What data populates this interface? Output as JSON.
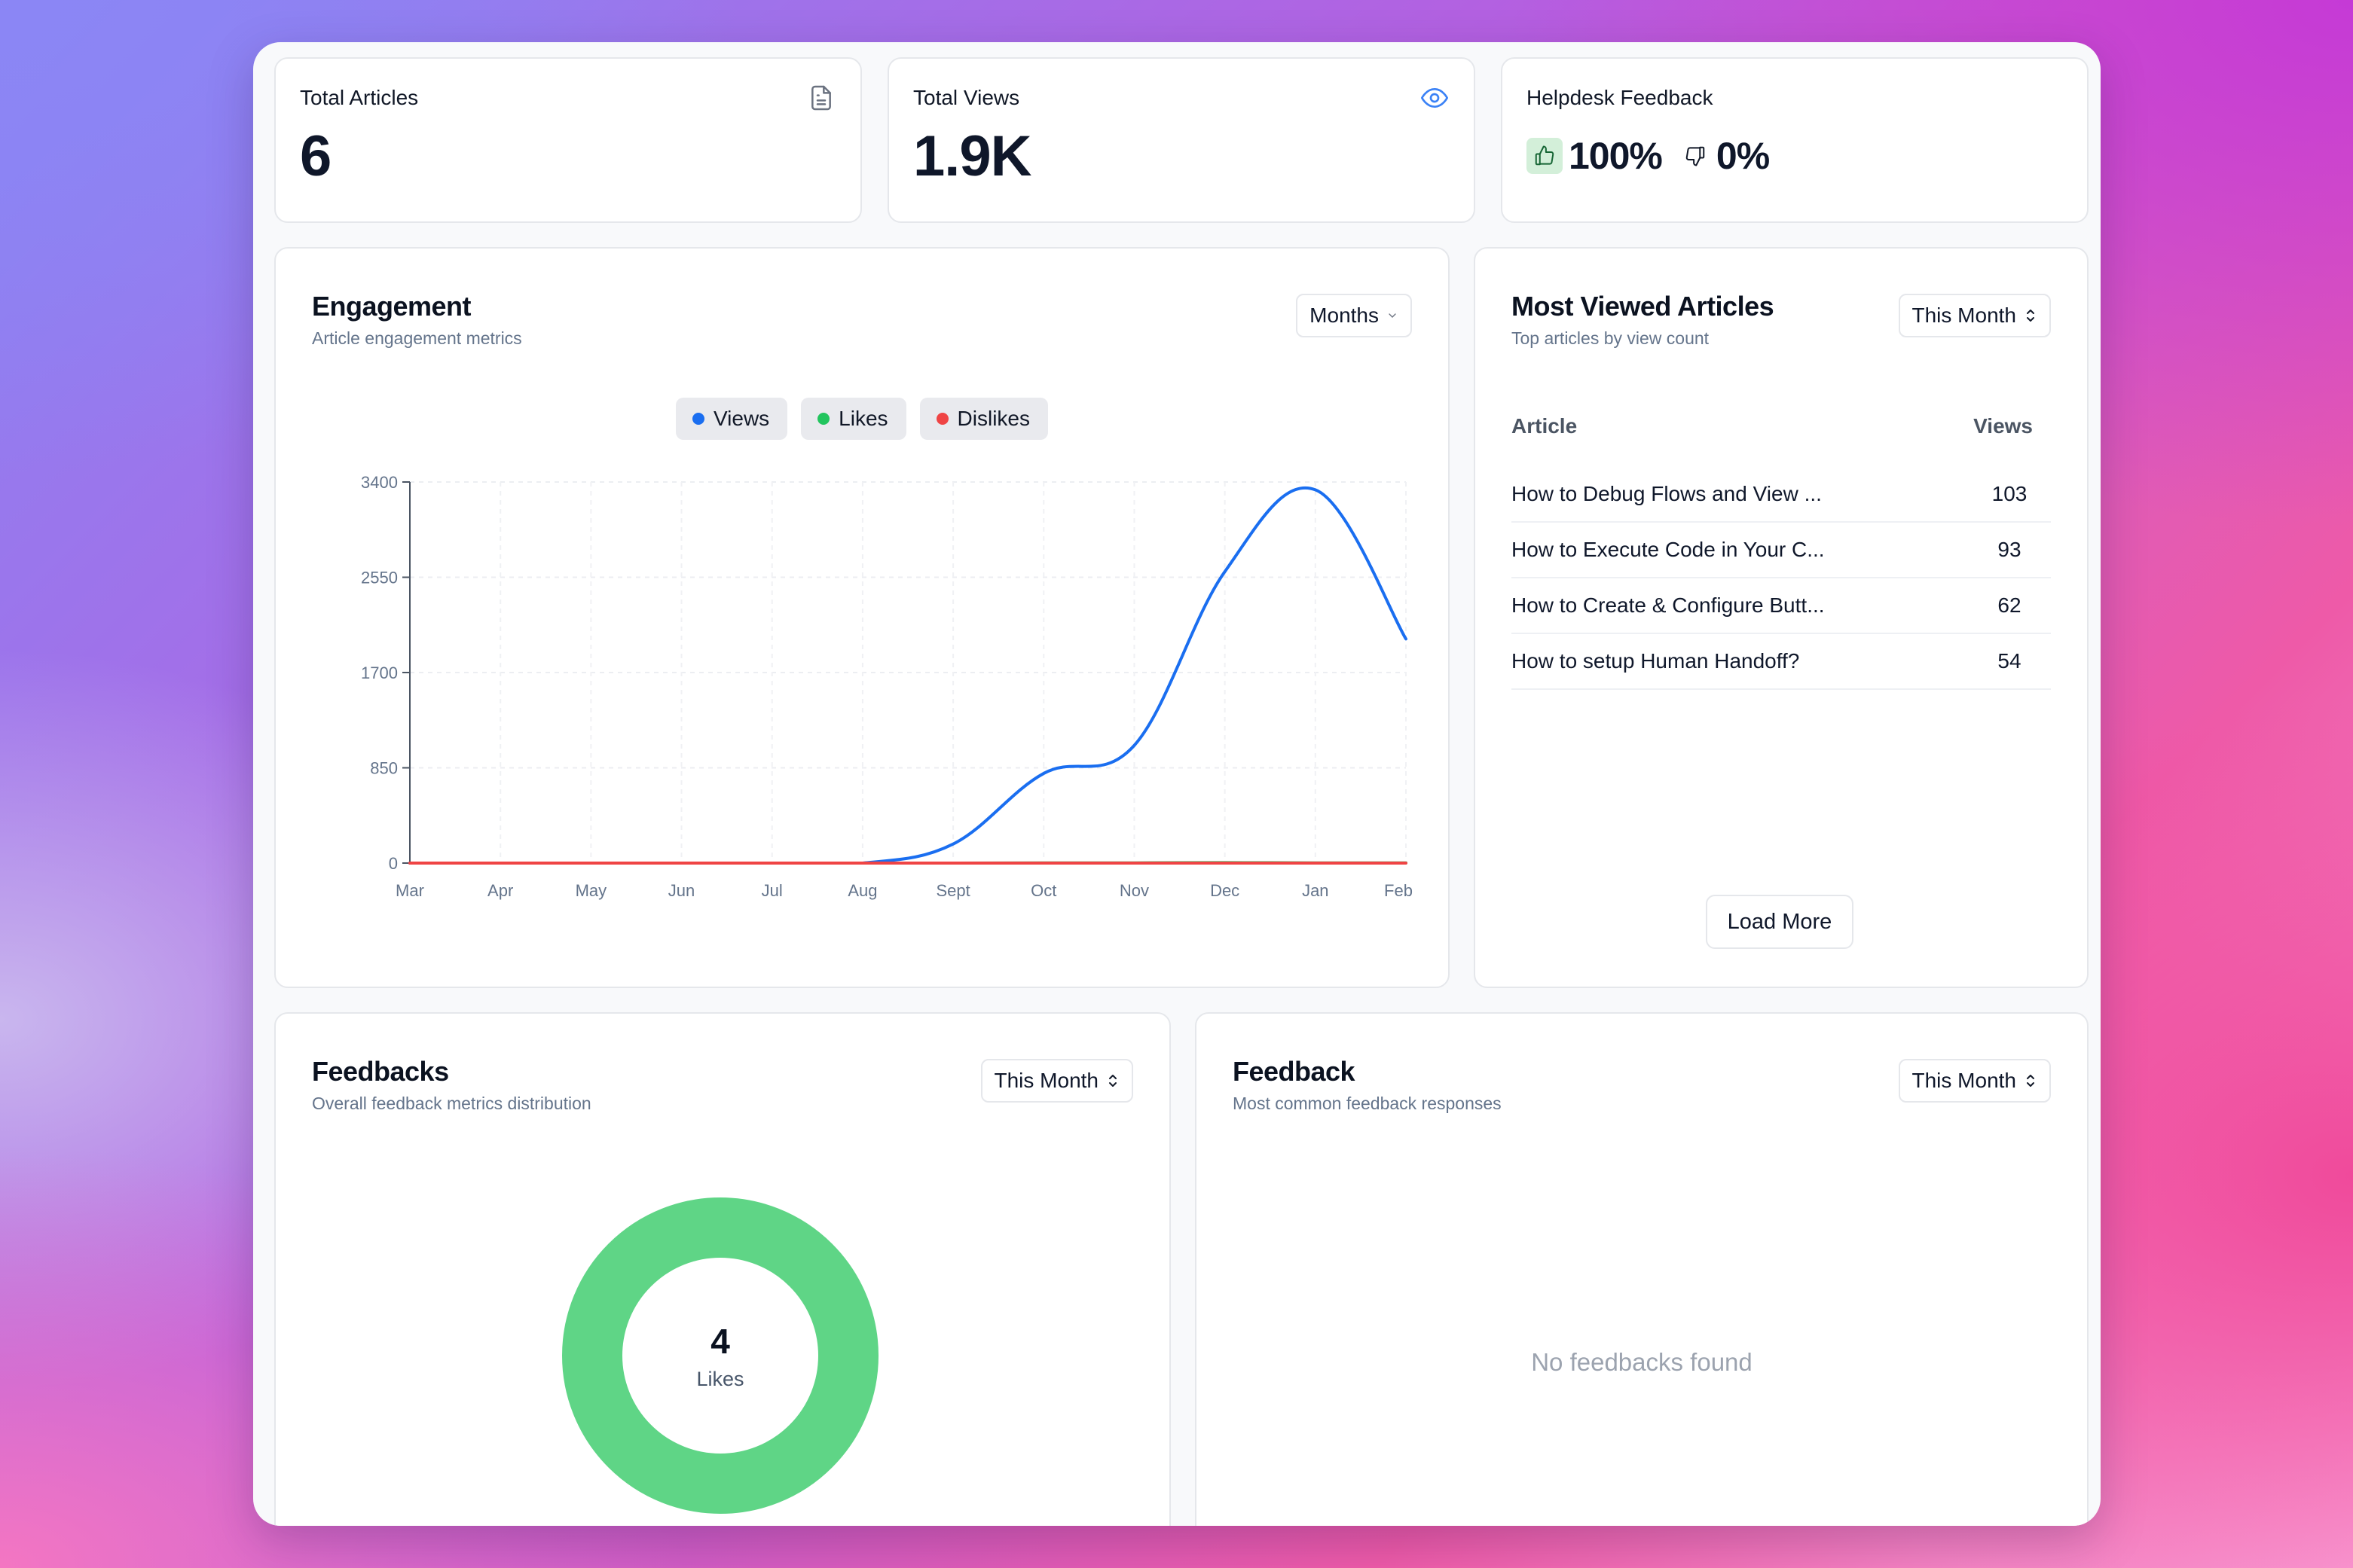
{
  "stats": {
    "total_articles": {
      "label": "Total Articles",
      "value": "6",
      "icon": "document-icon"
    },
    "total_views": {
      "label": "Total Views",
      "value": "1.9K",
      "icon": "eye-icon",
      "icon_color": "#3b82f6"
    },
    "helpdesk_feedback": {
      "label": "Helpdesk Feedback",
      "positive": "100%",
      "negative": "0%",
      "positive_icon": "thumbs-up-icon",
      "negative_icon": "thumbs-down-icon",
      "positive_bg": "#d3efd9"
    }
  },
  "engagement": {
    "title": "Engagement",
    "subtitle": "Article engagement metrics",
    "period_select": "Months",
    "legend": [
      {
        "name": "Views",
        "color": "#1a6ef0"
      },
      {
        "name": "Likes",
        "color": "#22c55e"
      },
      {
        "name": "Dislikes",
        "color": "#ef4444"
      }
    ]
  },
  "chart_data": {
    "type": "line",
    "title": "Engagement",
    "xlabel": "",
    "ylabel": "",
    "x": [
      "Mar",
      "Apr",
      "May",
      "Jun",
      "Jul",
      "Aug",
      "Sept",
      "Oct",
      "Nov",
      "Dec",
      "Jan",
      "Feb"
    ],
    "y_ticks": [
      0,
      850,
      1700,
      2550,
      3400
    ],
    "ylim": [
      0,
      3400
    ],
    "grid": true,
    "legend_position": "top-center",
    "smooth": true,
    "series": [
      {
        "name": "Views",
        "color": "#1a6ef0",
        "values": [
          0,
          0,
          0,
          0,
          0,
          0,
          170,
          800,
          1050,
          2600,
          3330,
          2000
        ]
      },
      {
        "name": "Likes",
        "color": "#22c55e",
        "values": [
          0,
          0,
          0,
          0,
          0,
          0,
          0,
          2,
          2,
          4,
          2,
          2
        ]
      },
      {
        "name": "Dislikes",
        "color": "#ef4444",
        "values": [
          0,
          0,
          0,
          0,
          0,
          0,
          0,
          0,
          0,
          0,
          0,
          0
        ]
      }
    ]
  },
  "most_viewed": {
    "title": "Most Viewed Articles",
    "subtitle": "Top articles by view count",
    "period_select": "This Month",
    "columns": [
      "Article",
      "Views"
    ],
    "rows": [
      {
        "article": "How to Debug Flows and View ...",
        "views": "103"
      },
      {
        "article": "How to Execute Code in Your C...",
        "views": "93"
      },
      {
        "article": "How to Create & Configure Butt...",
        "views": "62"
      },
      {
        "article": "How to setup Human Handoff?",
        "views": "54"
      }
    ],
    "load_more": "Load More"
  },
  "feedbacks": {
    "title": "Feedbacks",
    "subtitle": "Overall feedback metrics distribution",
    "period_select": "This Month",
    "donut": {
      "value": "4",
      "label": "Likes",
      "color": "#5fd586",
      "segments": [
        {
          "name": "Likes",
          "value": 4
        }
      ]
    }
  },
  "feedback": {
    "title": "Feedback",
    "subtitle": "Most common feedback responses",
    "period_select": "This Month",
    "empty_message": "No feedbacks found"
  }
}
